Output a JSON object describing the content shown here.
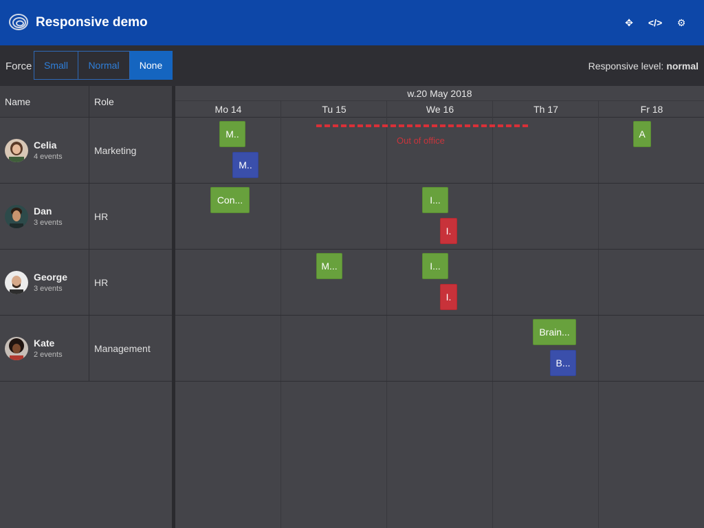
{
  "app": {
    "title": "Responsive demo"
  },
  "header_buttons": [
    {
      "name": "fullscreen-icon",
      "glyph": "✥"
    },
    {
      "name": "code-icon",
      "glyph": "</>"
    },
    {
      "name": "gear-icon",
      "glyph": "⚙"
    }
  ],
  "toolbar": {
    "force_label": "Force",
    "buttons": [
      "Small",
      "Normal",
      "None"
    ],
    "active": "None",
    "responsive_label": "Responsive level:",
    "responsive_value": "normal"
  },
  "grid": {
    "columns": [
      "Name",
      "Role"
    ],
    "rows": [
      {
        "name": "Celia",
        "events": "4 events",
        "role": "Marketing"
      },
      {
        "name": "Dan",
        "events": "3 events",
        "role": "HR"
      },
      {
        "name": "George",
        "events": "3 events",
        "role": "HR"
      },
      {
        "name": "Kate",
        "events": "2 events",
        "role": "Management"
      }
    ]
  },
  "schedule": {
    "week": "w.20 May 2018",
    "days": [
      "Mo 14",
      "Tu 15",
      "We 16",
      "Th 17",
      "Fr 18"
    ],
    "events": [
      {
        "text": "M..",
        "color": "green"
      },
      {
        "text": "M..",
        "color": "blue"
      },
      {
        "text": "A",
        "color": "green"
      },
      {
        "text": "Con...",
        "color": "green"
      },
      {
        "text": "I...",
        "color": "green"
      },
      {
        "text": "I.",
        "color": "red"
      },
      {
        "text": "M...",
        "color": "green"
      },
      {
        "text": "I...",
        "color": "green"
      },
      {
        "text": "I.",
        "color": "red"
      },
      {
        "text": "Brain...",
        "color": "green"
      },
      {
        "text": "B...",
        "color": "blue"
      }
    ],
    "out_of_office": "Out of office"
  },
  "colors": {
    "header": "#0d47a8",
    "green": "#68a13d",
    "blue": "#3a4fab",
    "red": "#c8323a"
  }
}
